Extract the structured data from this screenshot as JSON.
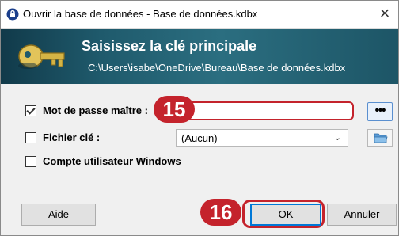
{
  "window": {
    "title": "Ouvrir la base de données - Base de données.kdbx",
    "close_glyph": "×"
  },
  "banner": {
    "title": "Saisissez la clé principale",
    "path": "C:\\Users\\isabe\\OneDrive\\Bureau\\Base de données.kdbx",
    "icon": "key-icon",
    "gradient_colors": [
      "#113a4a",
      "#2b6e80"
    ]
  },
  "master_password": {
    "label": "Mot de passe maître :",
    "checked": true,
    "value": "",
    "show_button_label": "•••"
  },
  "key_file": {
    "label": "Fichier clé :",
    "checked": false,
    "selected": "(Aucun)",
    "browse_icon": "folder-icon"
  },
  "windows_account": {
    "label": "Compte utilisateur Windows",
    "checked": false
  },
  "buttons": {
    "help": "Aide",
    "ok": "OK",
    "cancel": "Annuler"
  },
  "annotations": {
    "step_password": "15",
    "step_ok": "16",
    "color": "#c4232c"
  }
}
